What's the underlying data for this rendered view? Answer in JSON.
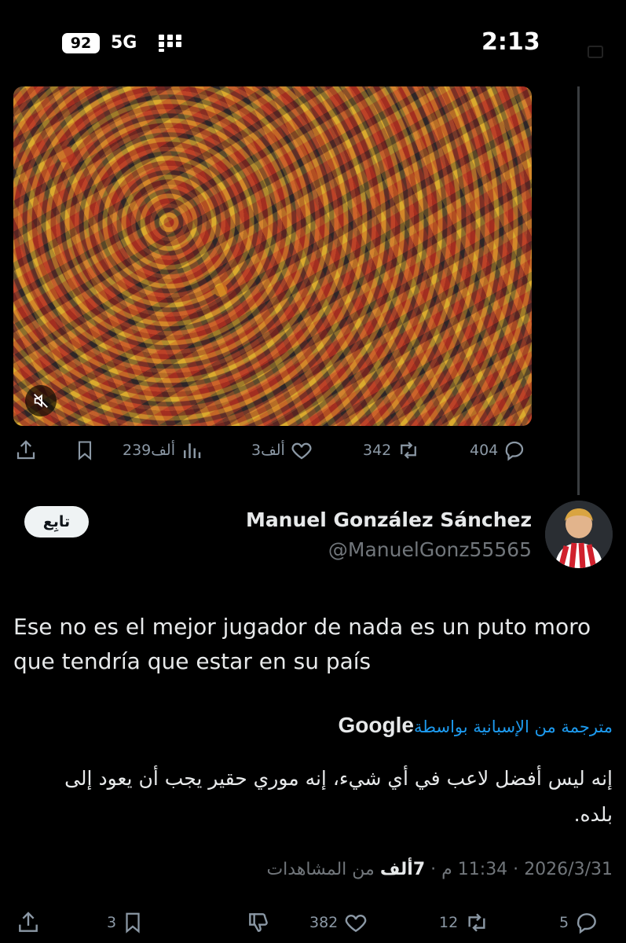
{
  "status_bar": {
    "time": "2:13",
    "battery": "92",
    "network": "5G"
  },
  "video_tweet_actions": {
    "replies": "404",
    "retweets": "342",
    "likes": "3ألف",
    "views": "239ألف"
  },
  "reply": {
    "author_name": "Manuel González Sánchez",
    "author_handle": "@ManuelGonz55565",
    "follow_label": "تابِع",
    "text": "Ese no es el mejor jugador de nada es un puto moro que tendría que estar en su país",
    "translated_by": "مترجمة من الإسبانية بواسطة",
    "translator": "Google",
    "translation": "إنه ليس أفضل لاعب في أي شيء، إنه موري حقير يجب أن يعود إلى بلده.",
    "meta": {
      "date": "2026/3/31",
      "time": "11:34 م",
      "views_count": "7ألف",
      "views_label": "من المشاهدات"
    },
    "actions": {
      "replies": "5",
      "retweets": "12",
      "likes": "382",
      "bookmarks": "3"
    }
  },
  "colors": {
    "background": "#000000",
    "text": "#e7e9ea",
    "secondary": "#71767b",
    "icon": "#8b98a5",
    "link": "#1d9bf0"
  },
  "icons": [
    "reply-icon",
    "retweet-icon",
    "like-icon",
    "views-icon",
    "bookmark-icon",
    "share-icon",
    "mute-icon",
    "dislike-icon"
  ]
}
